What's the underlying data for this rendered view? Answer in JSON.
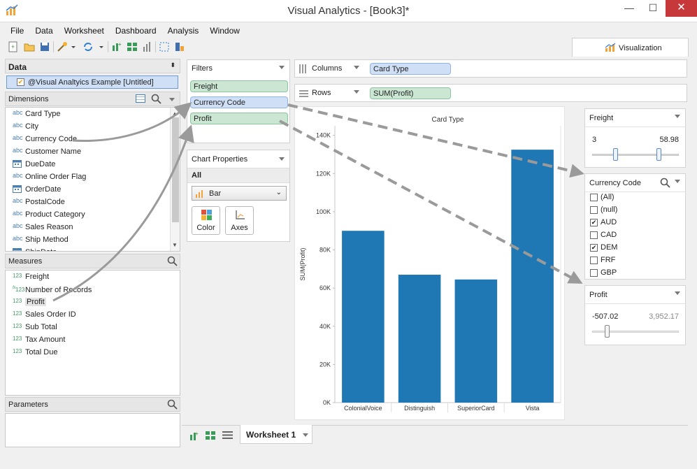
{
  "window": {
    "title": "Visual Analytics - [Book3]*",
    "min": "—",
    "max": "☐",
    "close": "✕"
  },
  "menu": [
    "File",
    "Data",
    "Worksheet",
    "Dashboard",
    "Analysis",
    "Window"
  ],
  "viz_tab": {
    "label": "Visualization"
  },
  "data_panel": {
    "header": "Data",
    "source": "@Visual Analtyics Example [Untitled]",
    "dimensions_header": "Dimensions",
    "dimensions": [
      {
        "type": "abc",
        "label": "Card Type"
      },
      {
        "type": "abc",
        "label": "City"
      },
      {
        "type": "abc",
        "label": "Currency Code"
      },
      {
        "type": "abc",
        "label": "Customer Name"
      },
      {
        "type": "date",
        "label": "DueDate"
      },
      {
        "type": "abc",
        "label": "Online Order Flag"
      },
      {
        "type": "date",
        "label": "OrderDate"
      },
      {
        "type": "abc",
        "label": "PostalCode"
      },
      {
        "type": "abc",
        "label": "Product Category"
      },
      {
        "type": "abc",
        "label": "Sales Reason"
      },
      {
        "type": "abc",
        "label": "Ship Method"
      },
      {
        "type": "date",
        "label": "ShipDate"
      }
    ],
    "measures_header": "Measures",
    "measures": [
      {
        "type": "123",
        "label": "Freight"
      },
      {
        "type": "fx123",
        "label": "Number of Records"
      },
      {
        "type": "123",
        "label": "Profit"
      },
      {
        "type": "123",
        "label": "Sales Order ID"
      },
      {
        "type": "123",
        "label": "Sub Total"
      },
      {
        "type": "123",
        "label": "Tax Amount"
      },
      {
        "type": "123",
        "label": "Total Due"
      }
    ],
    "parameters_header": "Parameters"
  },
  "filters": {
    "header": "Filters",
    "pills": [
      {
        "label": "Freight",
        "kind": "green"
      },
      {
        "label": "Currency Code",
        "kind": "blue"
      },
      {
        "label": "Profit",
        "kind": "green"
      }
    ]
  },
  "chart_properties": {
    "header": "Chart Properties",
    "scope": "All",
    "chart_type": "Bar",
    "color_label": "Color",
    "axes_label": "Axes"
  },
  "shelves": {
    "columns_label": "Columns",
    "columns_pill": "Card Type",
    "rows_label": "Rows",
    "rows_pill": "SUM(Profit)"
  },
  "chart_data": {
    "type": "bar",
    "title": "Card Type",
    "ylabel": "SUM(Profit)",
    "categories": [
      "ColonialVoice",
      "Distinguish",
      "SuperiorCard",
      "Vista"
    ],
    "values": [
      90000,
      67000,
      64500,
      132500
    ],
    "ylim": [
      0,
      145000
    ],
    "yticks": [
      0,
      20000,
      40000,
      60000,
      80000,
      100000,
      120000,
      140000
    ],
    "ytick_labels": [
      "0K",
      "20K",
      "40K",
      "60K",
      "80K",
      "100K",
      "120K",
      "140K"
    ],
    "bar_color": "#1f77b4",
    "grid": false
  },
  "freight_card": {
    "header": "Freight",
    "min": "3",
    "max": "58.98"
  },
  "currency_card": {
    "header": "Currency Code",
    "options": [
      {
        "label": "(All)",
        "checked": false
      },
      {
        "label": "(null)",
        "checked": false
      },
      {
        "label": "AUD",
        "checked": true
      },
      {
        "label": "CAD",
        "checked": false
      },
      {
        "label": "DEM",
        "checked": true
      },
      {
        "label": "FRF",
        "checked": false
      },
      {
        "label": "GBP",
        "checked": false
      }
    ]
  },
  "profit_card": {
    "header": "Profit",
    "min": "-507.02",
    "max": "3,952.17"
  },
  "sheet_tab": {
    "label": "Worksheet 1"
  },
  "colors": {
    "accent_bar": "#1f77b4",
    "pill_green": "#cbe7d4",
    "pill_blue": "#cfe0f6",
    "arrow": "#9a9a9a",
    "close_button": "#c7383b"
  }
}
